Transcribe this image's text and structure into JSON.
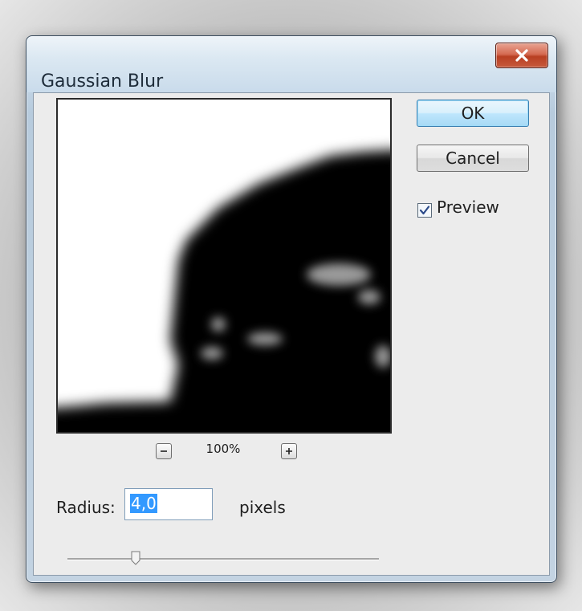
{
  "dialog": {
    "title": "Gaussian Blur",
    "close_icon": "close-icon"
  },
  "preview": {
    "zoom_out_icon": "zoom-out-icon",
    "zoom_in_icon": "zoom-in-icon",
    "zoom_value": "100%"
  },
  "buttons": {
    "ok_label": "OK",
    "cancel_label": "Cancel"
  },
  "preview_toggle": {
    "label": "Preview",
    "checked": true
  },
  "radius": {
    "label": "Radius:",
    "value": "4,0",
    "units": "pixels",
    "slider_level": 0.22
  },
  "colors": {
    "selection": "#3399ff",
    "close_button": "#c75a3c",
    "default_button": "#bee6fd"
  }
}
